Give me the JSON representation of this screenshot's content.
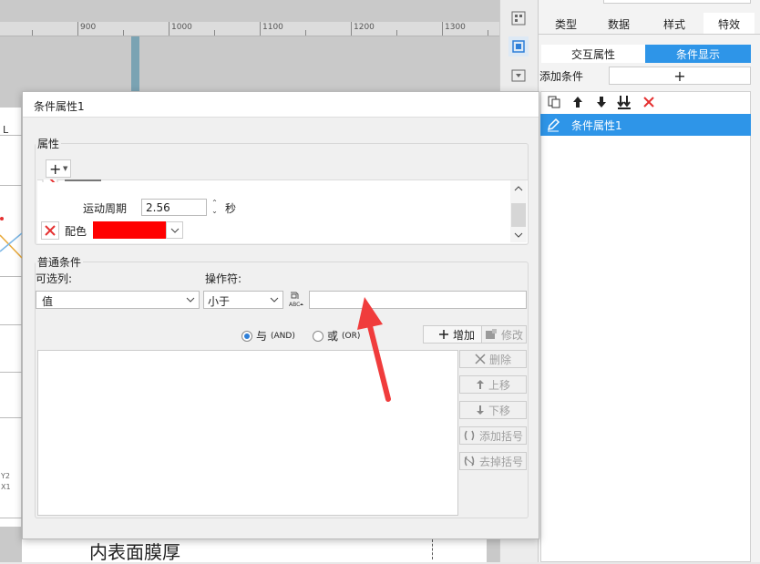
{
  "ruler": {
    "labels": [
      "900",
      "1000",
      "1100",
      "1200",
      "1300"
    ]
  },
  "sheet": {
    "col_label": "L",
    "y2_label": "Y2",
    "x1_label": "X1"
  },
  "canvas": {
    "bottom_text": "内表面膜厚"
  },
  "right_panel": {
    "tabs": [
      "类型",
      "数据",
      "样式",
      "特效"
    ],
    "subtabs": {
      "interaction": "交互属性",
      "condition": "条件显示"
    },
    "add_condition_label": "添加条件",
    "add_condition_button": "+",
    "selected_item": "条件属性1",
    "icons": [
      "copy-icon",
      "arrow-up-icon",
      "arrow-down-icon",
      "move-bottom-icon",
      "delete-x-icon"
    ]
  },
  "dialog": {
    "title": "条件属性1",
    "property_group": {
      "label": "属性",
      "add_button": "+",
      "period_label": "运动周期",
      "period_value": "2.56",
      "period_unit": "秒",
      "color_label": "配色",
      "color_value": "#ff0000"
    },
    "condition_group": {
      "label": "普通条件",
      "column_label": "可选列:",
      "column_value": "值",
      "operator_label": "操作符:",
      "operator_value": "小于",
      "value_input": "",
      "and_label": "与",
      "and_code": "(AND)",
      "or_label": "或",
      "or_code": "(OR)",
      "add_button": "增加",
      "modify_button": "修改",
      "delete_button": "删除",
      "move_up_button": "上移",
      "move_down_button": "下移",
      "add_bracket_button": "添加括号",
      "remove_bracket_button": "去掉括号"
    }
  },
  "colors": {
    "accent": "#2e95e8",
    "annotation_arrow": "#f03c3c"
  }
}
